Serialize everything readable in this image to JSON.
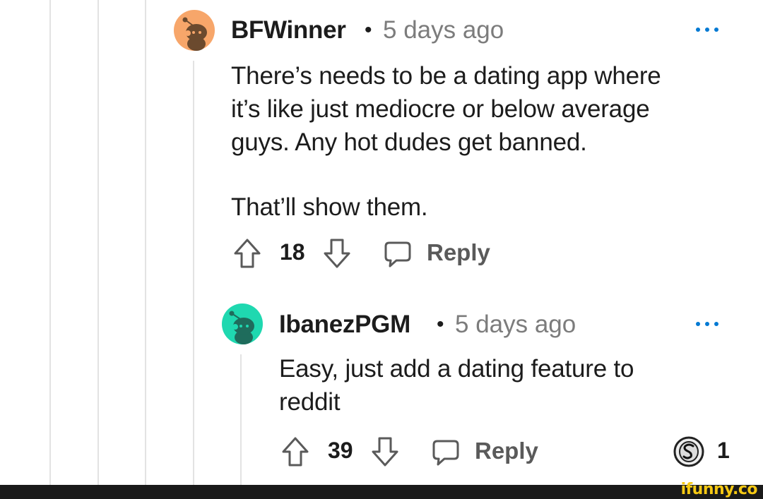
{
  "comments": [
    {
      "username": "BFWinner",
      "separator": "•",
      "time": "5 days ago",
      "avatar_icon": "reddit-snoo-avatar-icon",
      "avatar_color": "#f7a66a",
      "body_lines": [
        "There’s needs to be a dating app where",
        "it’s like just mediocre or below average",
        "guys. Any hot dudes get banned.",
        "That’ll show them."
      ],
      "votes": "18",
      "reply_label": "Reply"
    },
    {
      "username": "IbanezPGM",
      "separator": "•",
      "time": "5 days ago",
      "avatar_icon": "reddit-snoo-avatar-icon",
      "avatar_color": "#1fd8b0",
      "body_lines": [
        "Easy, just add a dating feature to",
        "reddit"
      ],
      "votes": "39",
      "reply_label": "Reply",
      "award_count": "1",
      "award_icon": "silver-award-icon"
    }
  ],
  "watermark": "ifunny.co",
  "colors": {
    "username": "#1c1c1c",
    "timestamp": "#7c7c7c",
    "reply": "#5a5a5a",
    "thread_line": "#e3e3e3",
    "more_dots": "#0079d3",
    "watermark": "#f6c913"
  }
}
